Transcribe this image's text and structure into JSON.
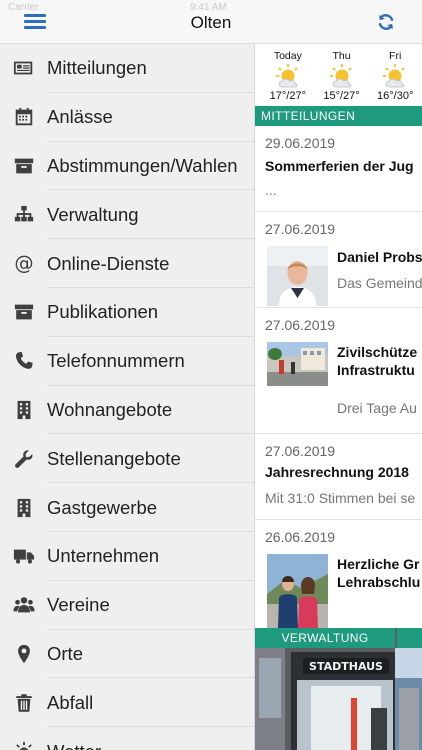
{
  "statusbar": {
    "carrier": "Carrier",
    "time": "9:41 AM"
  },
  "header": {
    "title": "Olten"
  },
  "sidebar": {
    "items": [
      {
        "label": "Mitteilungen",
        "icon": "newspaper-icon"
      },
      {
        "label": "Anlässe",
        "icon": "calendar-icon"
      },
      {
        "label": "Abstimmungen/Wahlen",
        "icon": "archive-box-icon"
      },
      {
        "label": "Verwaltung",
        "icon": "org-chart-icon"
      },
      {
        "label": "Online-Dienste",
        "icon": "at-sign-icon"
      },
      {
        "label": "Publikationen",
        "icon": "archive-box-icon"
      },
      {
        "label": "Telefonnummern",
        "icon": "phone-icon"
      },
      {
        "label": "Wohnangebote",
        "icon": "building-icon"
      },
      {
        "label": "Stellenangebote",
        "icon": "wrench-icon"
      },
      {
        "label": "Gastgewerbe",
        "icon": "building-icon"
      },
      {
        "label": "Unternehmen",
        "icon": "truck-icon"
      },
      {
        "label": "Vereine",
        "icon": "users-icon"
      },
      {
        "label": "Orte",
        "icon": "map-marker-icon"
      },
      {
        "label": "Abfall",
        "icon": "trash-icon"
      },
      {
        "label": "Wetter",
        "icon": "sun-icon"
      }
    ]
  },
  "weather": [
    {
      "day": "Today",
      "temp": "17°/27°"
    },
    {
      "day": "Thu",
      "temp": "15°/27°"
    },
    {
      "day": "Fri",
      "temp": "16°/30°"
    }
  ],
  "sections": {
    "news": "MITTEILUNGEN",
    "admin": "VERWALTUNG"
  },
  "news": [
    {
      "date": "29.06.2019",
      "title": "Sommerferien der Jug",
      "snippet": "..."
    },
    {
      "date": "27.06.2019",
      "title": "Daniel Probs",
      "snippet": "Das Gemeind"
    },
    {
      "date": "27.06.2019",
      "title": "Zivilschütze",
      "title2": "Infrastruktu",
      "snippet": "Drei Tage Au"
    },
    {
      "date": "27.06.2019",
      "title": "Jahresrechnung 2018",
      "snippet": "Mit 31:0 Stimmen bei se"
    },
    {
      "date": "26.06.2019",
      "title": "Herzliche Gr",
      "title2": "Lehrabschlu"
    }
  ],
  "admin_tile": {
    "sign": "STADTHAUS"
  },
  "colors": {
    "accent": "#2c6fbd",
    "section": "#1e9a7f",
    "sidebar_bg": "#efefef"
  }
}
